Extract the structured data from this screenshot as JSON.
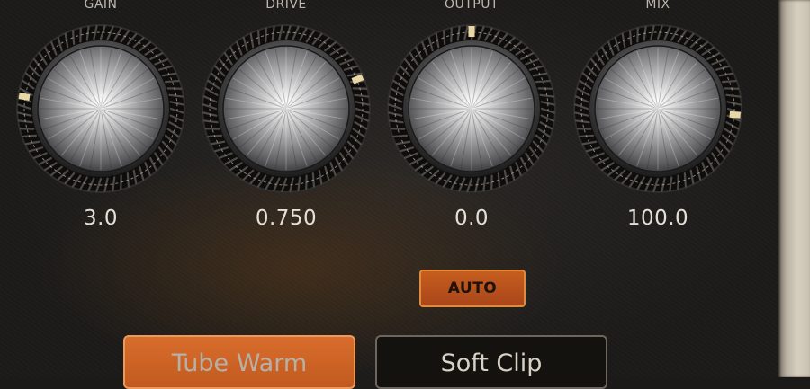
{
  "knobs": [
    {
      "label": "GAIN",
      "value": "3.0",
      "level": 0.2
    },
    {
      "label": "DRIVE",
      "value": "0.750",
      "level": 0.75
    },
    {
      "label": "OUTPUT",
      "value": "0.0",
      "level": 0.5
    },
    {
      "label": "MIX",
      "value": "100.0",
      "level": 0.85
    }
  ],
  "auto_button": {
    "label": "AUTO"
  },
  "mode_buttons": [
    {
      "label": "Tube Warm",
      "active": true
    },
    {
      "label": "Soft Clip",
      "active": false
    }
  ],
  "colors": {
    "accent": "#c75e1f",
    "indicator": "#e9d8a6",
    "background": "#1e1c1a"
  }
}
